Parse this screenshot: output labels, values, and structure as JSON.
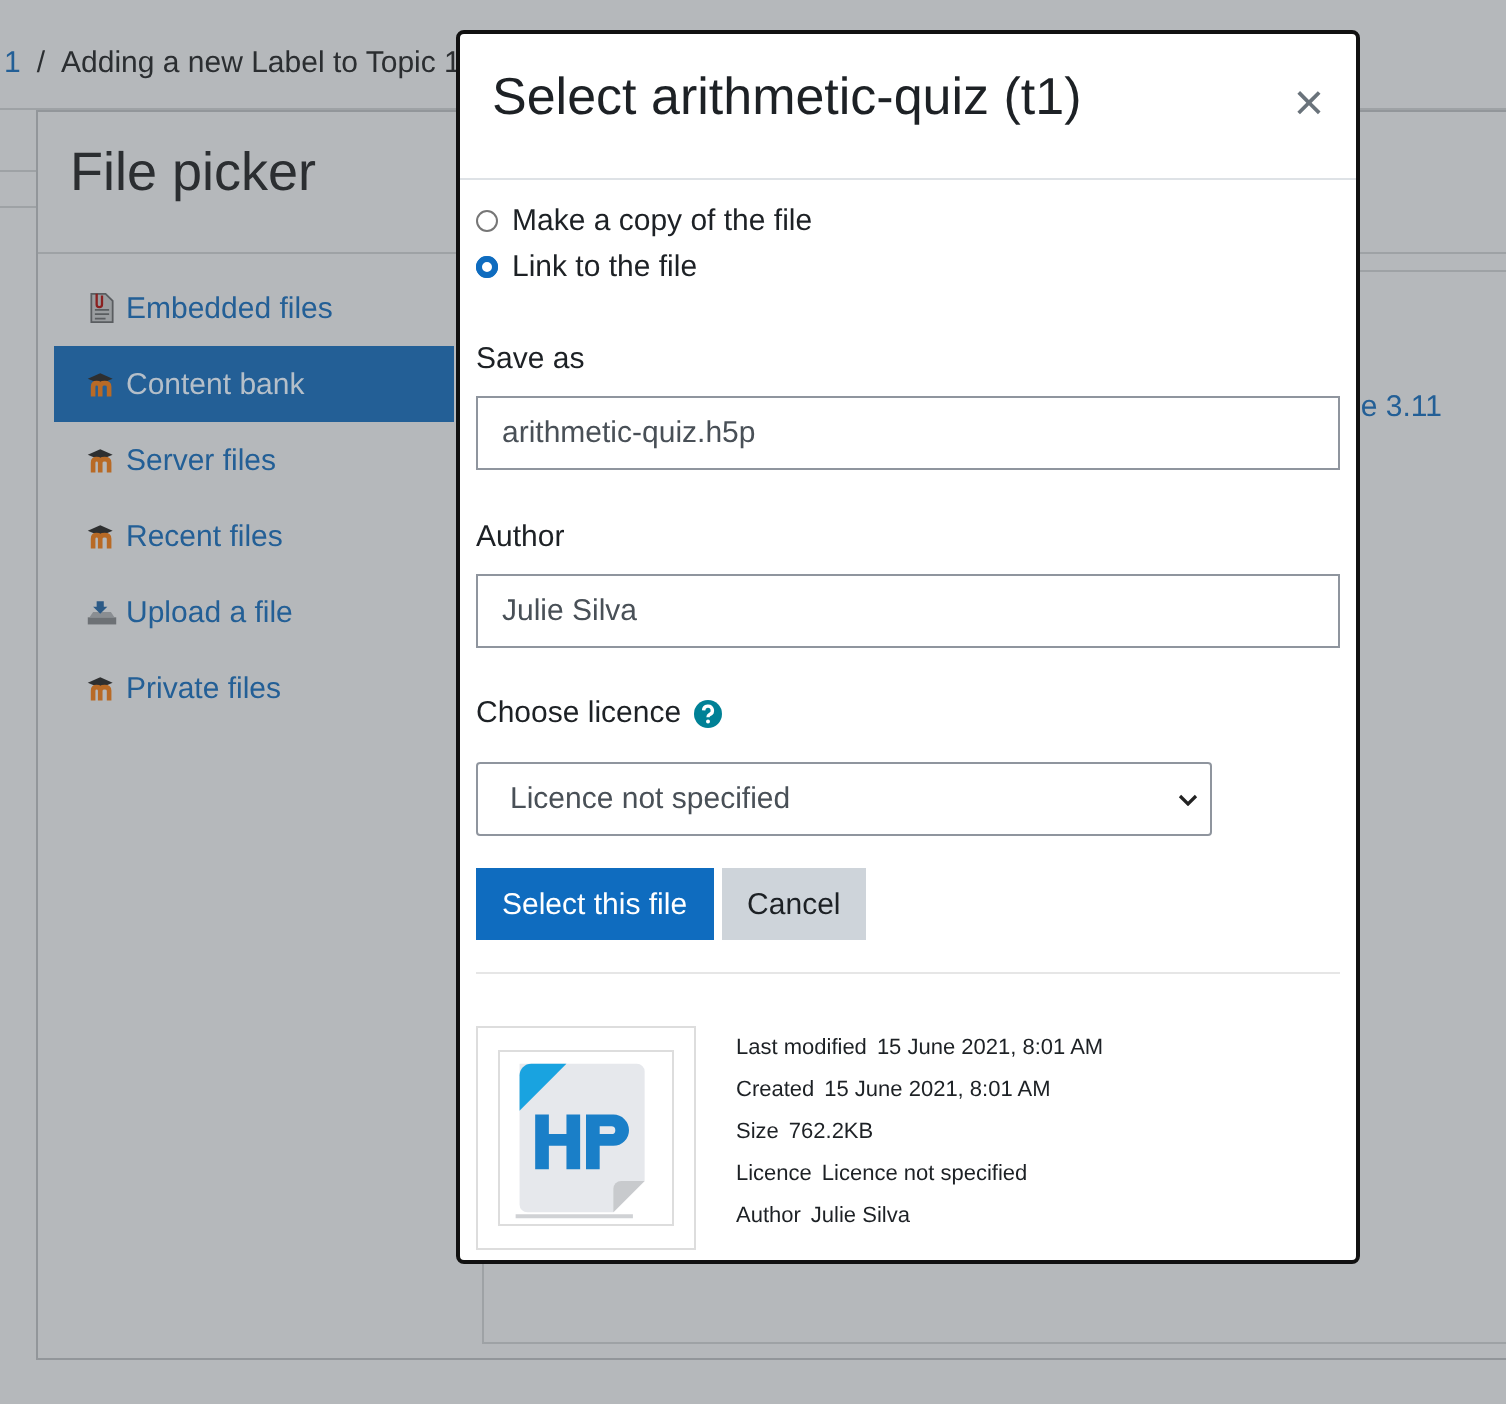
{
  "breadcrumb": [
    {
      "text": "1",
      "link": true
    },
    {
      "text": "/",
      "link": false
    },
    {
      "text": "Adding a new Label to Topic 1",
      "link": false
    }
  ],
  "file_picker": {
    "title": "File picker",
    "repositories": [
      {
        "label": "Embedded files",
        "kind": "document",
        "selected": false
      },
      {
        "label": "Content bank",
        "kind": "moodle",
        "selected": true
      },
      {
        "label": "Server files",
        "kind": "moodle",
        "selected": false
      },
      {
        "label": "Recent files",
        "kind": "moodle",
        "selected": false
      },
      {
        "label": "Upload a file",
        "kind": "upload",
        "selected": false
      },
      {
        "label": "Private files",
        "kind": "moodle",
        "selected": false
      }
    ],
    "content_link": "e 3.11"
  },
  "dialog": {
    "title": "Select arithmetic-quiz (t1)",
    "close": "×",
    "options": [
      {
        "label": "Make a copy of the file",
        "selected": false
      },
      {
        "label": "Link to the file",
        "selected": true
      }
    ],
    "save_as": {
      "label": "Save as",
      "value": "arithmetic-quiz.h5p"
    },
    "author": {
      "label": "Author",
      "value": "Julie Silva"
    },
    "licence": {
      "label": "Choose licence",
      "value": "Licence not specified"
    },
    "buttons": [
      {
        "label": "Select this file",
        "kind": "primary"
      },
      {
        "label": "Cancel",
        "kind": "secondary"
      }
    ],
    "details": [
      {
        "label": "Last modified",
        "value": "15 June 2021, 8:01 AM"
      },
      {
        "label": "Created",
        "value": "15 June 2021, 8:01 AM"
      },
      {
        "label": "Size",
        "value": "762.2KB"
      },
      {
        "label": "Licence",
        "value": "Licence not specified"
      },
      {
        "label": "Author",
        "value": "Julie Silva"
      }
    ]
  }
}
